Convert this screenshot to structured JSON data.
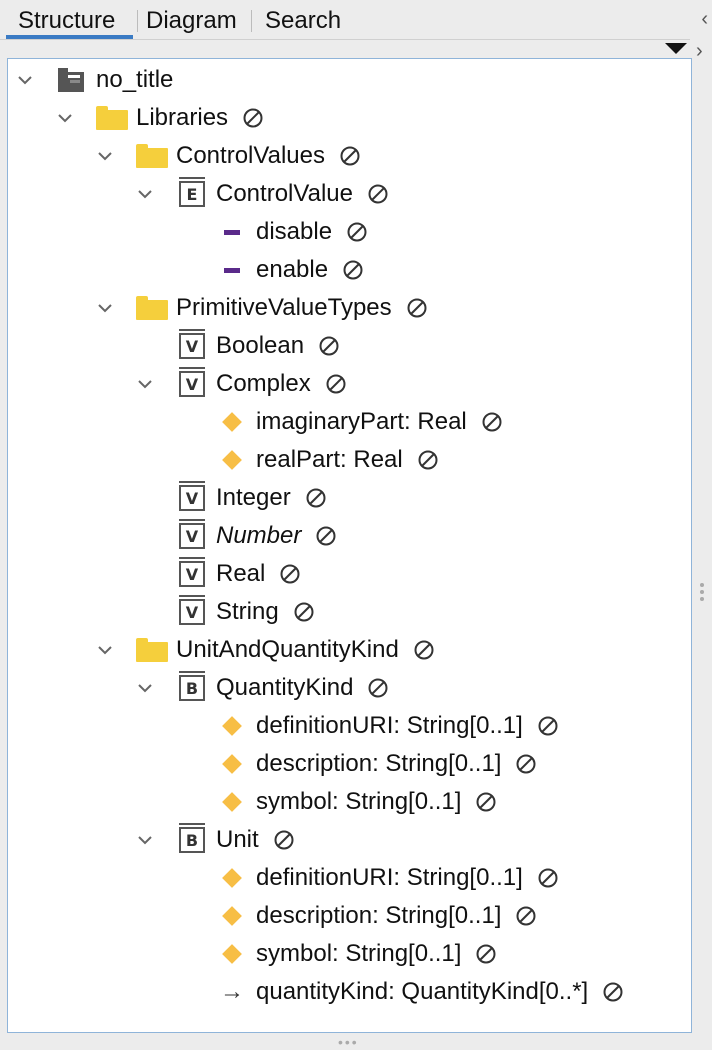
{
  "tabs": [
    {
      "label": "Structure",
      "active": true
    },
    {
      "label": "Diagram",
      "active": false
    },
    {
      "label": "Search",
      "active": false
    }
  ],
  "tree": [
    {
      "label": "no_title",
      "icon": "model-icon",
      "depth": 0,
      "expanded": true,
      "ban": false
    },
    {
      "label": "Libraries",
      "icon": "folder-icon",
      "depth": 1,
      "expanded": true,
      "ban": true
    },
    {
      "label": "ControlValues",
      "icon": "folder-icon",
      "depth": 2,
      "expanded": true,
      "ban": true
    },
    {
      "label": "ControlValue",
      "icon": "enumeration-icon",
      "glyph": "E",
      "depth": 3,
      "expanded": true,
      "ban": true
    },
    {
      "label": "disable",
      "icon": "enum-literal-icon",
      "depth": 4,
      "ban": true
    },
    {
      "label": "enable",
      "icon": "enum-literal-icon",
      "depth": 4,
      "ban": true
    },
    {
      "label": "PrimitiveValueTypes",
      "icon": "folder-icon",
      "depth": 2,
      "expanded": true,
      "ban": true
    },
    {
      "label": "Boolean",
      "icon": "value-type-icon",
      "glyph": "V",
      "depth": 3,
      "ban": true
    },
    {
      "label": "Complex",
      "icon": "value-type-icon",
      "glyph": "V",
      "depth": 3,
      "expanded": true,
      "ban": true
    },
    {
      "label": "imaginaryPart: Real",
      "icon": "property-icon",
      "depth": 4,
      "ban": true
    },
    {
      "label": "realPart: Real",
      "icon": "property-icon",
      "depth": 4,
      "ban": true
    },
    {
      "label": "Integer",
      "icon": "value-type-icon",
      "glyph": "V",
      "depth": 3,
      "ban": true
    },
    {
      "label": "Number",
      "icon": "value-type-icon",
      "glyph": "V",
      "depth": 3,
      "ban": true,
      "italic": true
    },
    {
      "label": "Real",
      "icon": "value-type-icon",
      "glyph": "V",
      "depth": 3,
      "ban": true
    },
    {
      "label": "String",
      "icon": "value-type-icon",
      "glyph": "V",
      "depth": 3,
      "ban": true
    },
    {
      "label": "UnitAndQuantityKind",
      "icon": "folder-icon",
      "depth": 2,
      "expanded": true,
      "ban": true
    },
    {
      "label": "QuantityKind",
      "icon": "block-icon",
      "glyph": "B",
      "depth": 3,
      "expanded": true,
      "ban": true
    },
    {
      "label": "definitionURI: String[0..1]",
      "icon": "property-icon",
      "depth": 4,
      "ban": true
    },
    {
      "label": "description: String[0..1]",
      "icon": "property-icon",
      "depth": 4,
      "ban": true
    },
    {
      "label": "symbol: String[0..1]",
      "icon": "property-icon",
      "depth": 4,
      "ban": true
    },
    {
      "label": "Unit",
      "icon": "block-icon",
      "glyph": "B",
      "depth": 3,
      "expanded": true,
      "ban": true
    },
    {
      "label": "definitionURI: String[0..1]",
      "icon": "property-icon",
      "depth": 4,
      "ban": true
    },
    {
      "label": "description: String[0..1]",
      "icon": "property-icon",
      "depth": 4,
      "ban": true
    },
    {
      "label": "symbol: String[0..1]",
      "icon": "property-icon",
      "depth": 4,
      "ban": true
    },
    {
      "label": "quantityKind: QuantityKind[0..*]",
      "icon": "reference-icon",
      "depth": 4,
      "ban": true
    }
  ],
  "colors": {
    "accent": "#3b7bc4",
    "folder": "#f5cf3c",
    "property": "#f7be45",
    "enum_literal": "#5a2a8a"
  }
}
